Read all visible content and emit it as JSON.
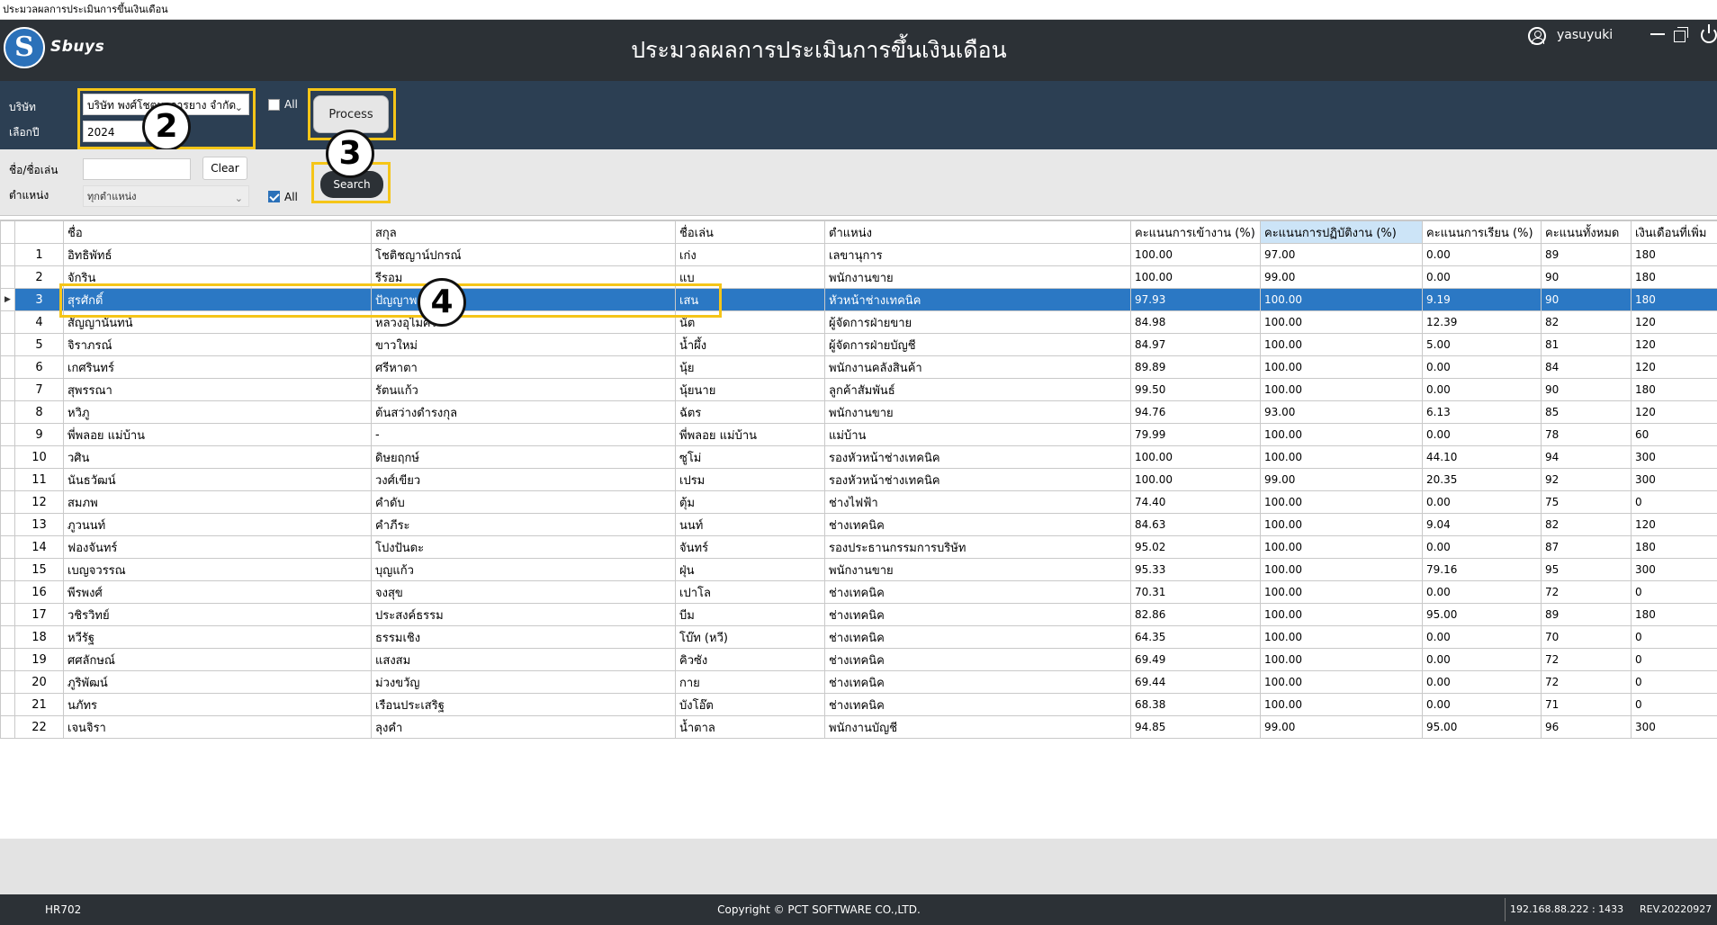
{
  "window": {
    "title": "ประมวลผลการประเมินการขึ้นเงินเดือน"
  },
  "header": {
    "logo_letter": "S",
    "logo_text": "Sbuys",
    "title": "ประมวลผลการประเมินการขึ้นเงินเดือน",
    "username": "yasuyuki"
  },
  "filter": {
    "company_label": "บริษัท",
    "company_value": "บริษัท พงศ์โชตนาการยาง จำกัด",
    "year_label": "เลือกปี",
    "year_value": "2024",
    "all_label": "All",
    "process_label": "Process"
  },
  "search": {
    "name_label": "ชื่อ/ชื่อเล่น",
    "name_value": "",
    "clear_label": "Clear",
    "position_label": "ตำแหน่ง",
    "position_value": "ทุกตำแหน่ง",
    "all_label": "All",
    "search_label": "Search"
  },
  "callouts": [
    "2",
    "3",
    "4"
  ],
  "grid": {
    "columns": [
      "",
      "",
      "ชื่อ",
      "สกุล",
      "ชื่อเล่น",
      "ตำแหน่ง",
      "คะแนนการเข้างาน (%)",
      "คะแนนการปฏิบัติงาน (%)",
      "คะแนนการเรียน (%)",
      "คะแนนทั้งหมด",
      "เงินเดือนที่เพิ่ม"
    ],
    "selected_marker": "▶",
    "rows": [
      [
        "1",
        "อิทธิพัทธ์",
        "โชติชญาน์ปกรณ์",
        "เก่ง",
        "เลขานุการ",
        "100.00",
        "97.00",
        "0.00",
        "89",
        "180"
      ],
      [
        "2",
        "จักริน",
        "รีรอม",
        "แบ",
        "พนักงานขาย",
        "100.00",
        "99.00",
        "0.00",
        "90",
        "180"
      ],
      [
        "3",
        "สุรศักดิ์",
        "ปัญญาพ",
        "เสน",
        "หัวหน้าช่างเทคนิค",
        "97.93",
        "100.00",
        "9.19",
        "90",
        "180"
      ],
      [
        "4",
        "สัญญานันทน์",
        "หลวงอุไมศร",
        "นัต",
        "ผู้จัดการฝ่ายขาย",
        "84.98",
        "100.00",
        "12.39",
        "82",
        "120"
      ],
      [
        "5",
        "จิราภรณ์",
        "ขาวใหม่",
        "น้ำผึ้ง",
        "ผู้จัดการฝ่ายบัญชี",
        "84.97",
        "100.00",
        "5.00",
        "81",
        "120"
      ],
      [
        "6",
        "เกศรินทร์",
        "ศรีหาตา",
        "นุ้ย",
        "พนักงานคลังสินค้า",
        "89.89",
        "100.00",
        "0.00",
        "84",
        "120"
      ],
      [
        "7",
        "สุพรรณา",
        "รัตนแก้ว",
        "นุ้ยนาย",
        "ลูกค้าสัมพันธ์",
        "99.50",
        "100.00",
        "0.00",
        "90",
        "180"
      ],
      [
        "8",
        "หวิภู",
        "ต้นสว่างดำรงกุล",
        "ฉัตร",
        "พนักงานขาย",
        "94.76",
        "93.00",
        "6.13",
        "85",
        "120"
      ],
      [
        "9",
        "พี่พลอย แม่บ้าน",
        "-",
        "พี่พลอย แม่บ้าน",
        "แม่บ้าน",
        "79.99",
        "100.00",
        "0.00",
        "78",
        "60"
      ],
      [
        "10",
        "วศิน",
        "ดิษยฤกษ์",
        "ซูโม่",
        "รองหัวหน้าช่างเทคนิค",
        "100.00",
        "100.00",
        "44.10",
        "94",
        "300"
      ],
      [
        "11",
        "นันธวัฒน์",
        "วงศ์เขียว",
        "เปรม",
        "รองหัวหน้าช่างเทคนิค",
        "100.00",
        "99.00",
        "20.35",
        "92",
        "300"
      ],
      [
        "12",
        "สมภพ",
        "คำดับ",
        "ตุ้ม",
        "ช่างไฟฟ้า",
        "74.40",
        "100.00",
        "0.00",
        "75",
        "0"
      ],
      [
        "13",
        "ภูวนนท์",
        "คำภีระ",
        "นนท์",
        "ช่างเทคนิค",
        "84.63",
        "100.00",
        "9.04",
        "82",
        "120"
      ],
      [
        "14",
        "ฟองจันทร์",
        "โปงปันดะ",
        "จันทร์",
        "รองประธานกรรมการบริษัท",
        "95.02",
        "100.00",
        "0.00",
        "87",
        "180"
      ],
      [
        "15",
        "เบญจวรรณ",
        "บุญแก้ว",
        "ฝุ่น",
        "พนักงานขาย",
        "95.33",
        "100.00",
        "79.16",
        "95",
        "300"
      ],
      [
        "16",
        "พีรพงศ์",
        "จงสุข",
        "เปาโล",
        "ช่างเทคนิค",
        "70.31",
        "100.00",
        "0.00",
        "72",
        "0"
      ],
      [
        "17",
        "วชิรวิทย์",
        "ประสงค์ธรรม",
        "บีม",
        "ช่างเทคนิค",
        "82.86",
        "100.00",
        "95.00",
        "89",
        "180"
      ],
      [
        "18",
        "หวีรัฐ",
        "ธรรมเชิง",
        "โบ๊ท (หวี)",
        "ช่างเทคนิค",
        "64.35",
        "100.00",
        "0.00",
        "70",
        "0"
      ],
      [
        "19",
        "ศศลักษณ์",
        "แสงสม",
        "คิวซัง",
        "ช่างเทคนิค",
        "69.49",
        "100.00",
        "0.00",
        "72",
        "0"
      ],
      [
        "20",
        "ภูริพัฒน์",
        "ม่วงขวัญ",
        "กาย",
        "ช่างเทคนิค",
        "69.44",
        "100.00",
        "0.00",
        "72",
        "0"
      ],
      [
        "21",
        "นภัทร",
        "เรือนประเสริฐ",
        "บังโอ๊ต",
        "ช่างเทคนิค",
        "68.38",
        "100.00",
        "0.00",
        "71",
        "0"
      ],
      [
        "22",
        "เจนจิรา",
        "ลุงคำ",
        "น้ำตาล",
        "พนักงานบัญชี",
        "94.85",
        "99.00",
        "95.00",
        "96",
        "300"
      ]
    ]
  },
  "status": {
    "code": "HR702",
    "copyright": "Copyright © PCT SOFTWARE CO.,LTD.",
    "ip": "192.168.88.222 : 1433",
    "rev": "REV.20220927"
  },
  "colors": {
    "header_bg": "#2c3136",
    "filter_bg": "#2c3f53",
    "selected_row": "#2b78c4",
    "highlight": "#f5c518"
  }
}
